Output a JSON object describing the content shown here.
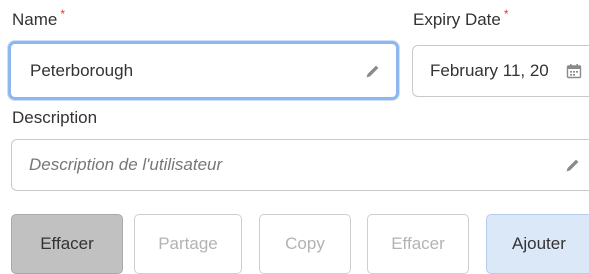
{
  "form": {
    "name": {
      "label": "Name",
      "required_marker": "*",
      "value": "Peterborough",
      "icon": "pencil-icon"
    },
    "expiry_date": {
      "label": "Expiry Date",
      "required_marker": "*",
      "value": "February 11, 20",
      "icon": "calendar-icon"
    },
    "description": {
      "label": "Description",
      "placeholder": "Description de l'utilisateur",
      "icon": "pencil-icon"
    }
  },
  "buttons": [
    {
      "label": "Effacer",
      "state": "active"
    },
    {
      "label": "Partage",
      "state": "disabled"
    },
    {
      "label": "Copy",
      "state": "disabled"
    },
    {
      "label": "Effacer",
      "state": "disabled"
    },
    {
      "label": "Ajouter",
      "state": "primary"
    }
  ],
  "colors": {
    "focus_border": "#8db8ef",
    "required": "#e53935",
    "active_button_bg": "#c1c1c1",
    "primary_button_bg": "#dbe8f8"
  }
}
